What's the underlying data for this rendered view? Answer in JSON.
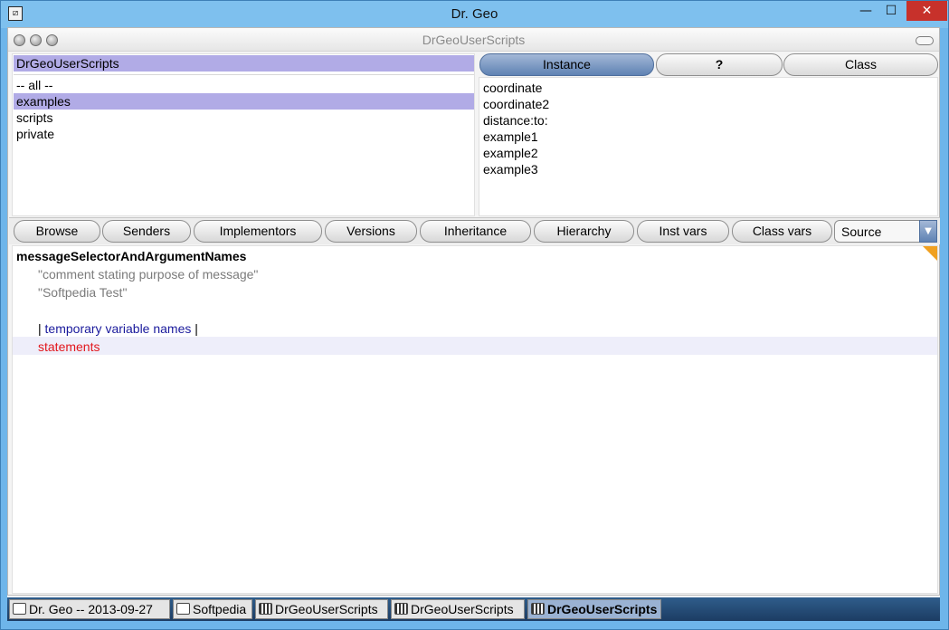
{
  "os_window": {
    "title": "Dr. Geo",
    "minimize_glyph": "—",
    "maximize_glyph": "☐",
    "close_glyph": "✕"
  },
  "browser_window": {
    "title": "DrGeoUserScripts"
  },
  "class_pane": {
    "selected_class": "DrGeoUserScripts",
    "categories": [
      "-- all --",
      "examples",
      "scripts",
      "private"
    ],
    "selected_category_index": 1
  },
  "side_tabs": {
    "instance_label": "Instance",
    "help_label": "?",
    "class_label": "Class",
    "active": "Instance"
  },
  "methods": [
    "coordinate",
    "coordinate2",
    "distance:to:",
    "example1",
    "example2",
    "example3"
  ],
  "toolbar": {
    "browse": "Browse",
    "senders": "Senders",
    "implementors": "Implementors",
    "versions": "Versions",
    "inheritance": "Inheritance",
    "hierarchy": "Hierarchy",
    "inst_vars": "Inst vars",
    "class_vars": "Class vars",
    "source": "Source"
  },
  "code": {
    "selector": "messageSelectorAndArgumentNames",
    "comment1": "\"comment stating purpose of message\"",
    "comment2": "\"Softpedia Test\"",
    "temps_open": "| ",
    "temps": "temporary variable names",
    "temps_close": " |",
    "statements": "statements"
  },
  "taskbar": [
    {
      "label": "Dr. Geo --  2013-09-27",
      "active": false
    },
    {
      "label": "Softpedia",
      "active": false
    },
    {
      "label": "DrGeoUserScripts",
      "active": false
    },
    {
      "label": "DrGeoUserScripts",
      "active": false
    },
    {
      "label": "DrGeoUserScripts",
      "active": true
    }
  ],
  "colors": {
    "selection": "#b1abe6",
    "active_tab": "#5f82b3",
    "comment": "#7b7b7b",
    "temp_var": "#1a1a9c",
    "statement": "#e2161c"
  }
}
